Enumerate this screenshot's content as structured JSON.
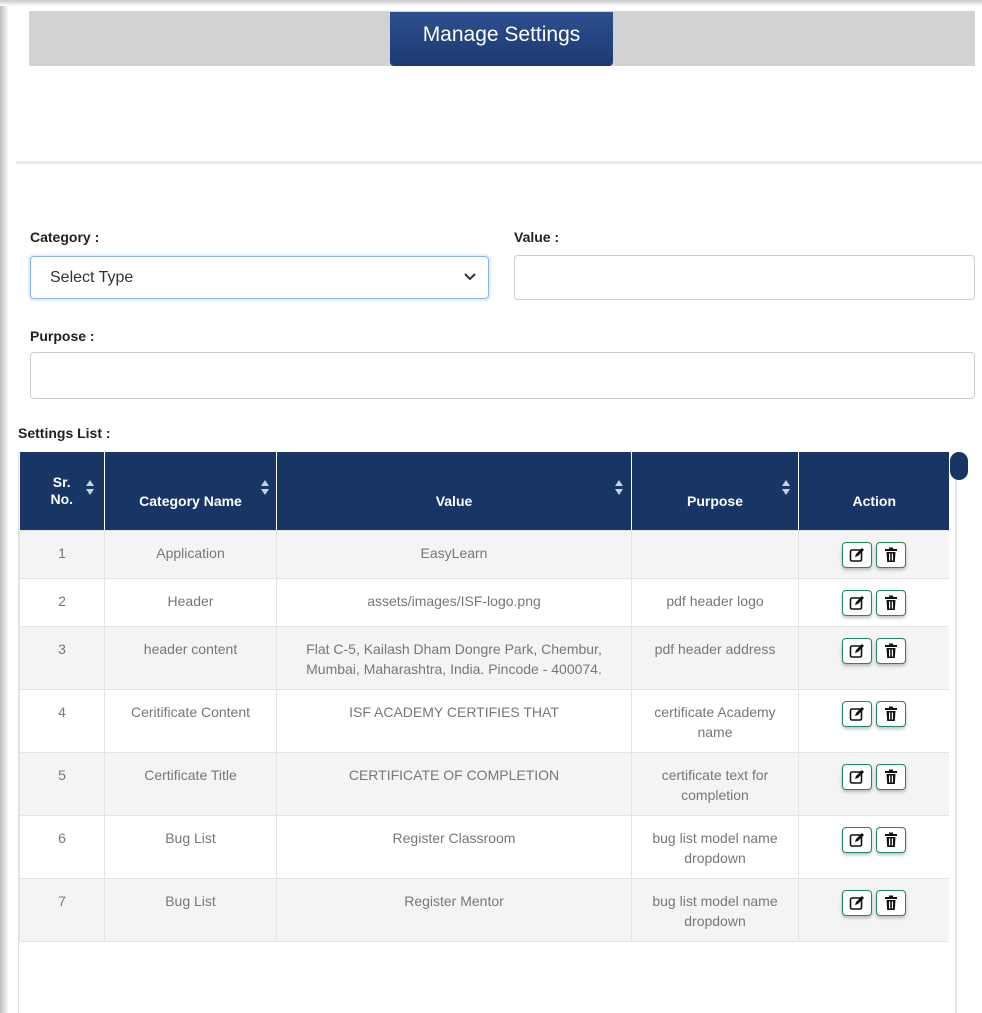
{
  "header": {
    "title": "Manage Settings"
  },
  "form": {
    "category_label": "Category :",
    "category_selected": "Select Type",
    "value_label": "Value :",
    "value_input": "",
    "purpose_label": "Purpose :",
    "purpose_input": ""
  },
  "table": {
    "caption": "Settings List :",
    "headers": {
      "sr_no_line1": "Sr.",
      "sr_no_line2": "No.",
      "category": "Category Name",
      "value": "Value",
      "purpose": "Purpose",
      "action": "Action"
    },
    "rows": [
      {
        "sr": "1",
        "category": "Application",
        "value": "EasyLearn",
        "purpose": ""
      },
      {
        "sr": "2",
        "category": "Header",
        "value": "assets/images/ISF-logo.png",
        "purpose": "pdf header logo"
      },
      {
        "sr": "3",
        "category": "header content",
        "value": "Flat C-5, Kailash Dham Dongre Park, Chembur, Mumbai, Maharashtra, India. Pincode - 400074.",
        "purpose": "pdf header address"
      },
      {
        "sr": "4",
        "category": "Ceritificate Content",
        "value": "ISF ACADEMY CERTIFIES THAT",
        "purpose": "certificate Academy name"
      },
      {
        "sr": "5",
        "category": "Certificate Title",
        "value": "CERTIFICATE OF COMPLETION",
        "purpose": "certificate text for completion"
      },
      {
        "sr": "6",
        "category": "Bug List",
        "value": "Register Classroom",
        "purpose": "bug list model name dropdown"
      },
      {
        "sr": "7",
        "category": "Bug List",
        "value": "Register Mentor",
        "purpose": "bug list model name dropdown"
      }
    ]
  },
  "icons": {
    "edit": "edit-icon",
    "delete": "trash-icon",
    "select_arrow": "chevron-down-icon"
  },
  "colors": {
    "header_navy": "#173565",
    "action_green": "#1f8a5a",
    "title_blue": "#1b3a73"
  }
}
